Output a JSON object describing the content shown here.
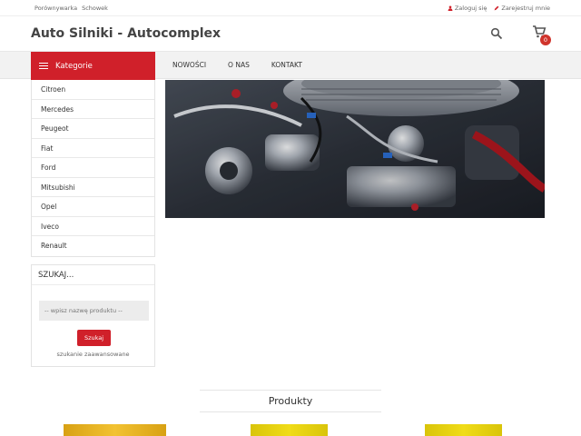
{
  "topbar": {
    "links": [
      "Porównywarka",
      "Schowek"
    ],
    "login": "Zaloguj się",
    "register": "Zarejestruj mnie"
  },
  "header": {
    "title": "Auto Silniki - Autocomplex",
    "cart_count": "0"
  },
  "nav": {
    "categories_label": "Kategorie",
    "menu": [
      "NOWOŚCI",
      "O NAS",
      "KONTAKT"
    ]
  },
  "categories": [
    "Citroen",
    "Mercedes",
    "Peugeot",
    "Fiat",
    "Ford",
    "Mitsubishi",
    "Opel",
    "Iveco",
    "Renault"
  ],
  "search": {
    "title": "SZUKAJ...",
    "placeholder": "-- wpisz nazwę produktu --",
    "button": "Szukaj",
    "advanced": "szukanie zaawansowane"
  },
  "products": {
    "heading": "Produkty"
  },
  "colors": {
    "accent": "#d0202a",
    "badge": "#d0342c"
  }
}
